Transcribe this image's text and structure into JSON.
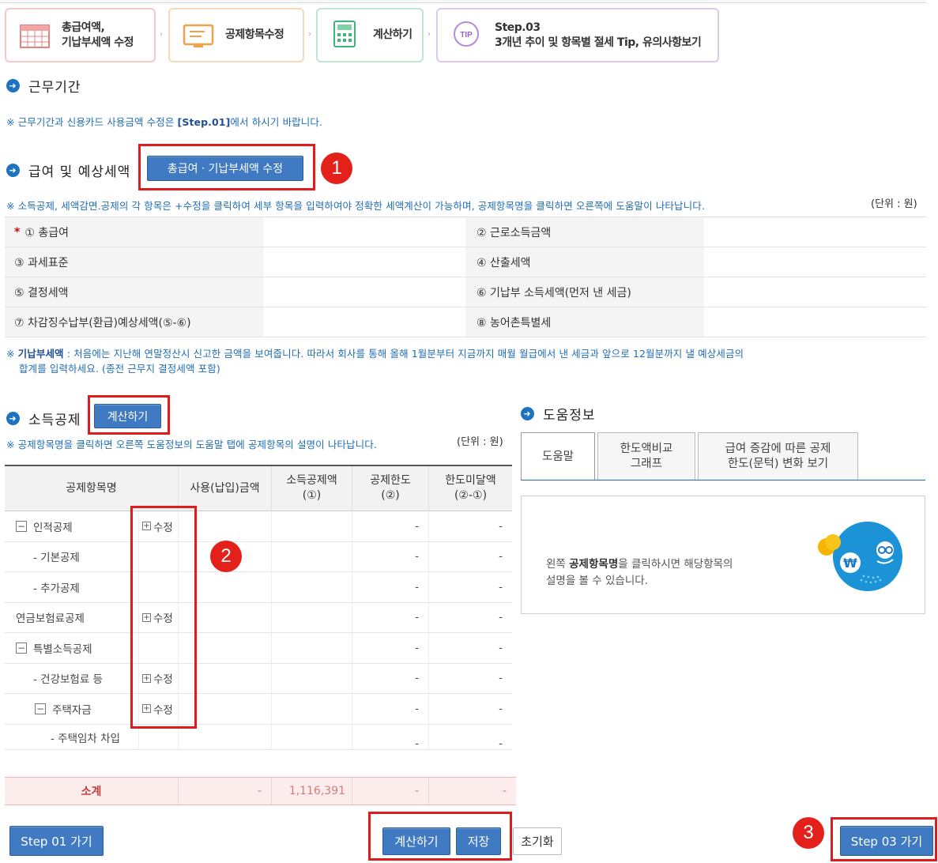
{
  "steps": [
    {
      "label_line1": "총급여액,",
      "label_line2": "기납부세액 수정",
      "icon": "calendar-icon"
    },
    {
      "label": "공제항목수정",
      "icon": "monitor-icon"
    },
    {
      "label": "계산하기",
      "icon": "calculator-icon"
    },
    {
      "label_line1": "Step.03",
      "label_line2": "3개년 추이 및 항목별 절세 Tip, 유의사항보기",
      "icon": "tip-icon",
      "icon_text": "TIP"
    }
  ],
  "work_period": {
    "title": "근무기간",
    "note_pre": "※ 근무기간과 신용카드 사용금액 수정은 ",
    "note_bold": "[Step.01]",
    "note_post": "에서 하시기 바랍니다."
  },
  "salary": {
    "title": "급여 및 예상세액",
    "edit_button": "총급여ㆍ기납부세액 수정",
    "note": "※ 소득공제, 세액감면.공제의 각 항목은 +수정을 클릭하여 세부 항목을 입력하여야 정확한 세액계산이 가능하며, 공제항목명을 클릭하면 오른쪽에 도움말이 나타납니다.",
    "unit": "(단위 : 원)",
    "required_mark": "*",
    "rows": [
      {
        "left": "① 총급여",
        "right": "② 근로소득금액"
      },
      {
        "left": "③ 과세표준",
        "right": "④ 산출세액"
      },
      {
        "left": "⑤ 결정세액",
        "right": "⑥ 기납부 소득세액(먼저 낸 세금)"
      },
      {
        "left": "⑦ 차감징수납부(환급)예상세액(⑤-⑥)",
        "right": "⑧ 농어촌특별세"
      }
    ],
    "paid_note_bold": "기납부세액",
    "paid_note_line1": " : 처음에는 지난해 연말정산시 신고한 금액을 보여줍니다. 따라서 회사를 통해 올해 1월분부터 지금까지 매월 월급에서 낸 세금과 앞으로 12월분까지 낼 예상세금의",
    "paid_note_line2": "합계를 입력하세요. (종전 근무지 결정세액 포함)",
    "paid_note_prefix": "※ "
  },
  "deduction": {
    "title": "소득공제",
    "calc_button": "계산하기",
    "note": "※ 공제항목명을 클릭하면 오른쪽 도움정보의 도움말 탭에 공제항목의 설명이 나타납니다.",
    "unit": "(단위 : 원)",
    "headers": [
      "공제항목명",
      "사용(납입)금액",
      "소득공제액 (①)",
      "공제한도 (②)",
      "한도미달액 (②-①)"
    ],
    "rows": [
      {
        "name": "인적공제",
        "toggle": "−",
        "edit": "수정",
        "limit": "-",
        "short": "-"
      },
      {
        "name": "- 기본공제",
        "indent": 1,
        "edit": "",
        "limit": "-",
        "short": "-"
      },
      {
        "name": "- 추가공제",
        "indent": 1,
        "edit": "",
        "limit": "-",
        "short": "-"
      },
      {
        "name": "연금보험료공제",
        "edit": "수정",
        "limit": "-",
        "short": "-"
      },
      {
        "name": "특별소득공제",
        "toggle": "−",
        "edit": "",
        "limit": "-",
        "short": "-"
      },
      {
        "name": "- 건강보험료 등",
        "indent": 1,
        "edit": "수정",
        "limit": "-",
        "short": "-"
      },
      {
        "name": "주택자금",
        "toggle": "−",
        "indent": 1,
        "edit": "수정",
        "limit": "-",
        "short": "-"
      },
      {
        "name": "- 주택임차 차입",
        "indent": 2,
        "edit": "",
        "limit": "-",
        "short": "-"
      }
    ],
    "subtotal": {
      "label": "소계",
      "used": "-",
      "deduction": "1,116,391",
      "limit": "-",
      "short": "-"
    }
  },
  "help": {
    "title": "도움정보",
    "tabs": [
      "도움말",
      "한도액비교\n그래프",
      "급여 증감에 따른 공제\n한도(문턱) 변화 보기"
    ],
    "text_pre": "왼쪽 ",
    "text_bold": "공제항목명",
    "text_post": "을 클릭하시면 해당항목의",
    "text_line2": "설명을 볼 수 있습니다.",
    "mascot_symbol": "₩"
  },
  "footer": {
    "step1_button": "Step 01 가기",
    "calc_button": "계산하기",
    "save_button": "저장",
    "reset_button": "초기화",
    "step3_button": "Step 03 가기"
  },
  "annotations": [
    "1",
    "2",
    "3"
  ],
  "colors": {
    "accent": "#3f7ac2",
    "annotation_red": "#e01b1b",
    "note_blue": "#1f6db4"
  }
}
